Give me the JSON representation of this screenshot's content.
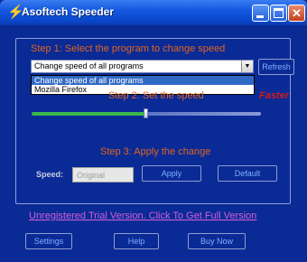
{
  "window": {
    "title": "Asoftech Speeder",
    "icon": "lightning-bolt-icon",
    "controls": {
      "minimize": "minimize-icon",
      "maximize": "maximize-icon",
      "close": "close-icon"
    }
  },
  "step1": {
    "label": "Step 1: Select the program to change speed",
    "selected": "Change speed of all programs",
    "options": [
      "Change speed of all programs",
      "Mozilla Firefox"
    ],
    "refresh_label": "Refresh"
  },
  "step2": {
    "label": "Step 2: Set the speed",
    "faster_label": "Faster",
    "slider_level": 0.5
  },
  "step3": {
    "label": "Step 3: Apply the change",
    "speed_label": "Speed:",
    "speed_value": "Original",
    "apply_label": "Apply",
    "default_label": "Default"
  },
  "footer": {
    "trial_link": "Unregistered Trial Version. Click To Get Full Version",
    "settings_label": "Settings",
    "help_label": "Help",
    "buy_label": "Buy Now"
  },
  "colors": {
    "background": "#0a2a96",
    "step_text": "#e0651e",
    "faster_text": "#d41a1a",
    "link": "#d35fd8",
    "button_text": "#7fb0ff"
  }
}
